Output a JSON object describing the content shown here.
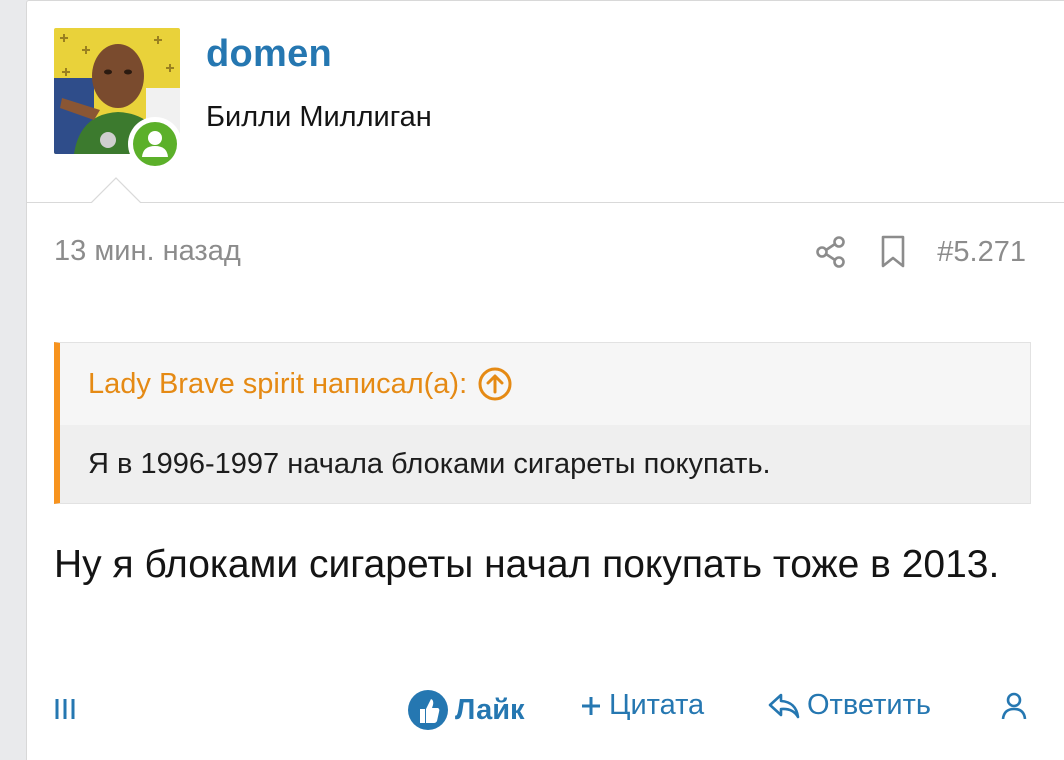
{
  "user": {
    "name": "domen",
    "title": "Билли Миллиган",
    "status_color": "#5cb02a"
  },
  "meta": {
    "time": "13 мин. назад",
    "post_number": "#5.271",
    "icons": [
      "share-icon",
      "bookmark-icon"
    ]
  },
  "quote": {
    "author_line": "Lady Brave spirit написал(а):",
    "text": "Я в 1996-1997 начала блоками сигареты покупать.",
    "accent_color": "#f7931e"
  },
  "message": {
    "text": "Ну я блоками сигареты начал покупать тоже в 2013."
  },
  "footer": {
    "like_label": "Лайк",
    "quote_label": "Цитата",
    "reply_label": "Ответить"
  },
  "colors": {
    "link": "#2577b1",
    "muted": "#8c8c8c"
  }
}
